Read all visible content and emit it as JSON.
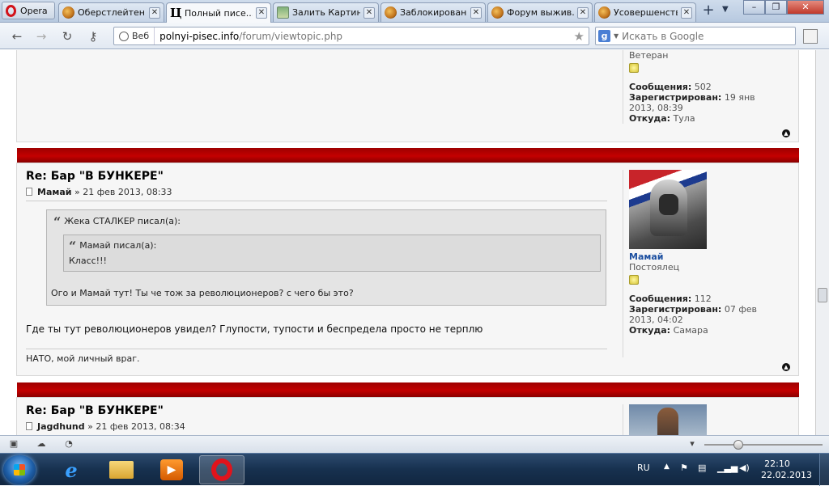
{
  "browser": {
    "menu_label": "Opera",
    "tabs": [
      {
        "label": "Оберстлейтен...",
        "icon": "forum-avatar-icon",
        "active": false
      },
      {
        "label": "Полный писе...",
        "icon": "polnyi-pisec-icon",
        "active": true
      },
      {
        "label": "Залить Картин...",
        "icon": "image-host-icon",
        "active": false
      },
      {
        "label": "Заблокирован...",
        "icon": "forum-avatar-icon",
        "active": false
      },
      {
        "label": "Форум выжив...",
        "icon": "forum-avatar-icon",
        "active": false
      },
      {
        "label": "Усовершенств...",
        "icon": "forum-avatar-icon",
        "active": false
      }
    ],
    "address": {
      "badge": "Веб",
      "domain": "polnyi-pisec.info",
      "path": "/forum/viewtopic.php"
    },
    "search_placeholder": "Искать в Google"
  },
  "prev_post": {
    "rank": "Ветеран",
    "posts_label": "Сообщения:",
    "posts": "502",
    "reg_label": "Зарегистрирован:",
    "reg_date": "19 янв 2013, 08:39",
    "from_label": "Откуда:",
    "from": "Тула"
  },
  "post1": {
    "title": "Re: Бар \"В БУНКЕРЕ\"",
    "author": "Мамай",
    "date": " » 21 фев 2013, 08:33",
    "outer_quote_head": "Жека СТАЛКЕР писал(а):",
    "inner_quote_head": "Мамай писал(а):",
    "inner_quote_text": "Класс!!!",
    "outer_quote_text": "Ого и Мамай тут! Ты че тож за революционеров? с чего бы это?",
    "body": "Где ты тут революционеров увидел? Глупости, тупости и беспредела просто не терплю",
    "signature": "НАТО, мой личный враг.",
    "profile": {
      "username": "Мамай",
      "rank": "Постоялец",
      "posts_label": "Сообщения:",
      "posts": "112",
      "reg_label": "Зарегистрирован:",
      "reg_date": "07 фев 2013, 04:02",
      "from_label": "Откуда:",
      "from": "Самара"
    }
  },
  "post2": {
    "title": "Re: Бар \"В БУНКЕРЕ\"",
    "author": "Jagdhund",
    "date": " » 21 фев 2013, 08:34"
  },
  "taskbar": {
    "lang": "RU",
    "time": "22:10",
    "date": "22.02.2013"
  },
  "colors": {
    "post_band": "#c40000",
    "username": "#1c4fa0",
    "taskbar": "#17314f"
  }
}
